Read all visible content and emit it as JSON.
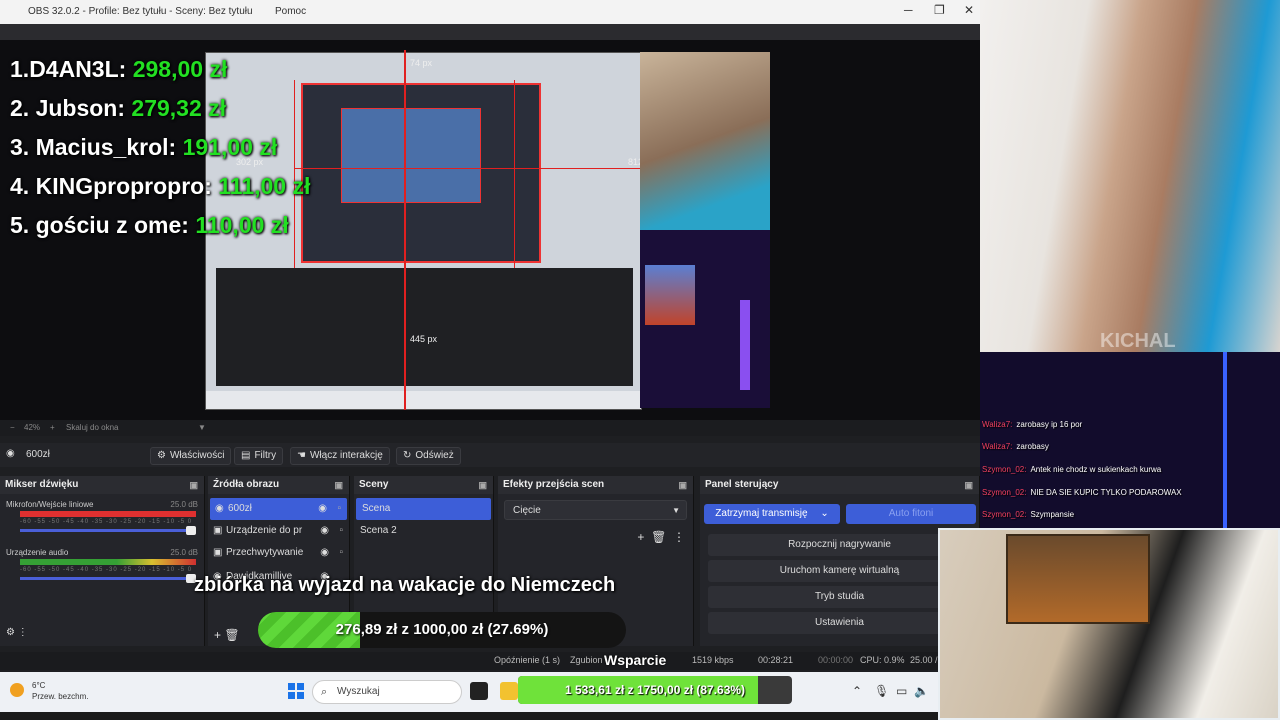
{
  "obs": {
    "title": "OBS 32.0.2 - Profile: Bez tytułu - Sceny: Bez tytułu",
    "menu_last": "Pomoc",
    "preview": {
      "px_top": "74 px",
      "px_left": "302 px",
      "px_right": "812 px",
      "px_bottom": "445 px"
    },
    "zoom": {
      "percent": "42%",
      "fit_label": "Skaluj do okna"
    },
    "source_toolbar": {
      "selected_source": "600zł",
      "properties": "Właściwości",
      "filters": "Filtry",
      "interact": "Włącz interakcję",
      "refresh": "Odśwież"
    },
    "mixer": {
      "title": "Mikser dźwięku",
      "channels": [
        {
          "name": "Mikrofon/Wejście liniowe",
          "db": "25.0 dB"
        },
        {
          "name": "Urządzenie audio",
          "db": "25.0 dB"
        }
      ],
      "scale": "-60 -55 -50 -45 -40 -35 -30 -25 -20 -15 -10 -5 0"
    },
    "sources": {
      "title": "Źródła obrazu",
      "items": [
        "600zł",
        "Urządzenie do pr",
        "Przechwytywanie",
        "Dawidkamillive"
      ]
    },
    "scenes": {
      "title": "Sceny",
      "items": [
        "Scena",
        "Scena 2"
      ]
    },
    "transitions": {
      "title": "Efekty przejścia scen",
      "selected": "Cięcie"
    },
    "controls": {
      "title": "Panel sterujący",
      "stop_stream": "Zatrzymaj transmisję",
      "auto_label": "Auto fitoni",
      "record": "Rozpocznij nagrywanie",
      "virtual_cam": "Uruchom kamerę wirtualną",
      "studio": "Tryb studia",
      "settings": "Ustawienia"
    },
    "status": {
      "delay": "Opóźnienie (1 s)",
      "zgubion": "Zgubion",
      "kbps": "1519 kbps",
      "time1": "00:28:21",
      "time2": "00:00:00",
      "cpu": "CPU: 0.9%",
      "fps": "25.00 /"
    }
  },
  "leaderboard": [
    {
      "rank": "1.",
      "name": "D4AN3L:",
      "amount": "298,00 zł"
    },
    {
      "rank": "2.",
      "name": "Jubson:",
      "amount": "279,32 zł"
    },
    {
      "rank": "3.",
      "name": "Macius_krol:",
      "amount": "191,00 zł"
    },
    {
      "rank": "4.",
      "name": "KINGpropropro:",
      "amount": "111,00 zł"
    },
    {
      "rank": "5.",
      "name": "gościu z ome:",
      "amount": "110,00 zł"
    }
  ],
  "goal": {
    "title": "zbiórka na wyjazd na wakacje do Niemczech",
    "label": "276,89 zł z 1000,00 zł (27.69%)",
    "progress": 0.2769
  },
  "support": {
    "title": "Wsparcie",
    "label": "1 533,61 zł z 1750,00 zł (87.63%)",
    "progress": 0.8763
  },
  "taskbar": {
    "temp": "6°C",
    "weather": "Przew. bezchm.",
    "search": "Wyszukaj"
  },
  "chat": [
    {
      "user": "Waliza7:",
      "text": "zarobasy ip 16 por"
    },
    {
      "user": "Waliza7:",
      "text": "zarobasy"
    },
    {
      "user": "Szymon_02:",
      "text": "Antek nie chodz w sukienkach kurwa"
    },
    {
      "user": "Szymon_02:",
      "text": "NIE DA SIE KUPIC TYLKO PODAROWAX"
    },
    {
      "user": "Szymon_02:",
      "text": "Szympansie"
    }
  ],
  "watermark": "KICHAL",
  "colors": {
    "accent": "#3d5ed8",
    "money": "#22e022",
    "goal": "#5fd83a"
  }
}
